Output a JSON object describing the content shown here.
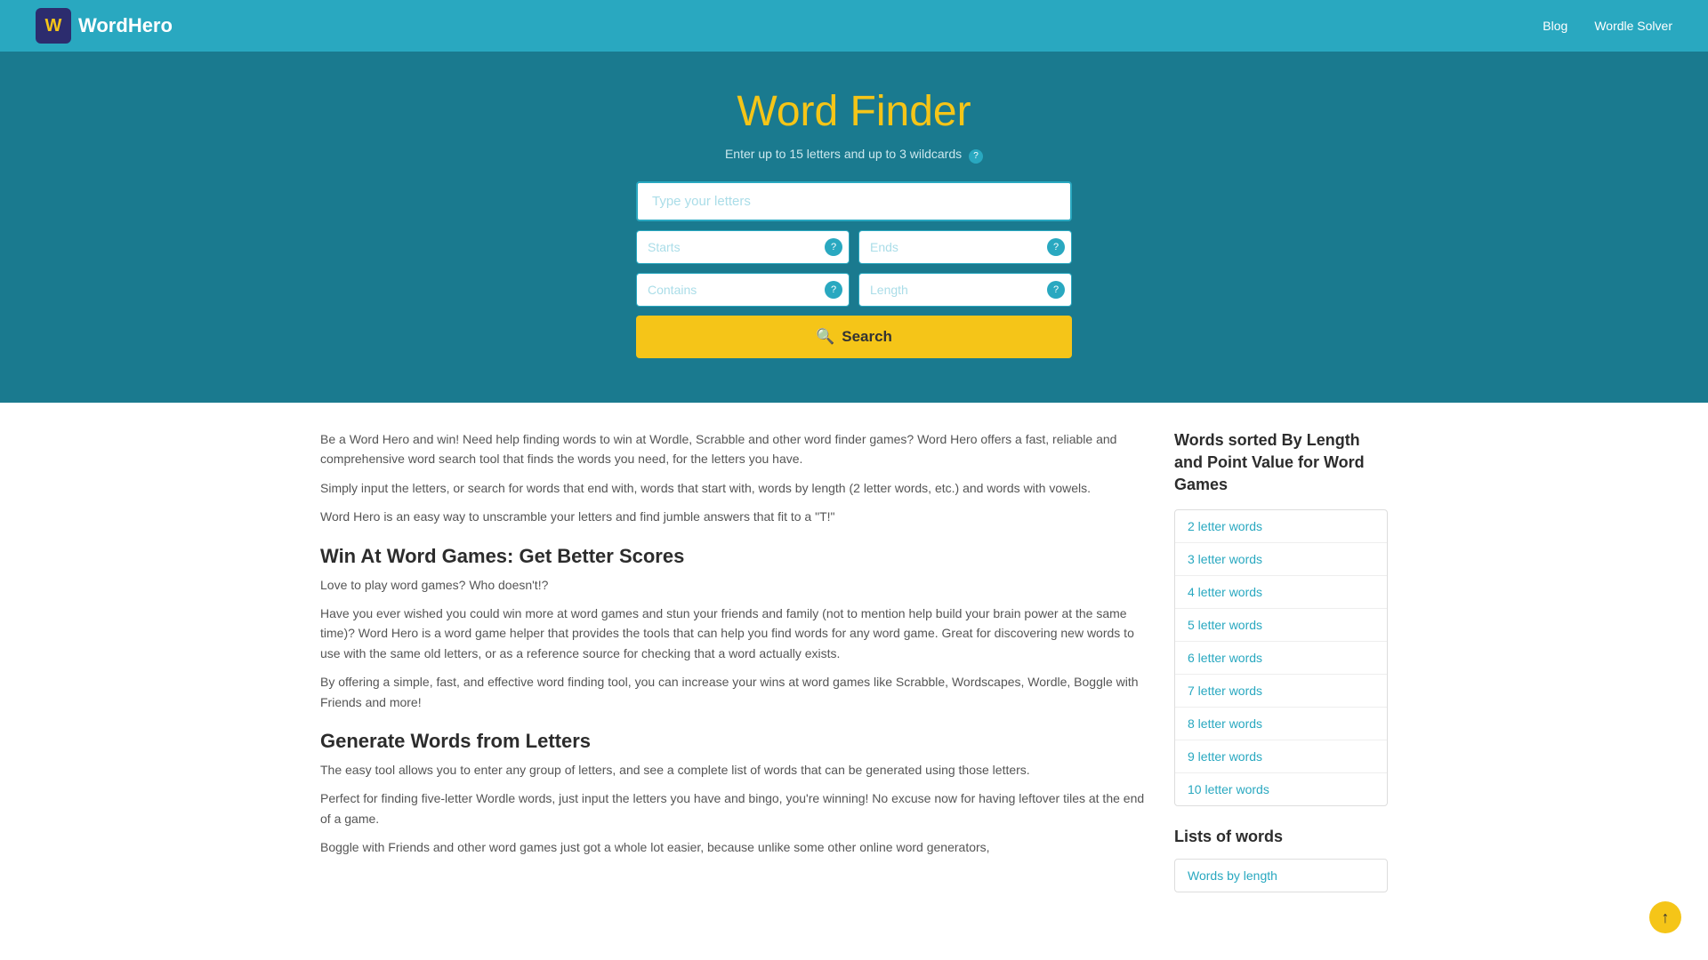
{
  "header": {
    "logo_text_part1": "Word",
    "logo_text_part2": "Hero",
    "logo_icon_letter": "W",
    "nav": {
      "blog_label": "Blog",
      "wordle_solver_label": "Wordle Solver"
    }
  },
  "hero": {
    "title_part1": "Word ",
    "title_part2": "Finder",
    "subtitle": "Enter up to 15 letters and up to 3 wildcards",
    "help_label": "?",
    "main_input_placeholder": "Type your letters",
    "starts_placeholder": "Starts",
    "ends_placeholder": "Ends",
    "contains_placeholder": "Contains",
    "length_placeholder": "Length",
    "search_button_label": "Search"
  },
  "content": {
    "intro1": "Be a Word Hero and win! Need help finding words to win at Wordle, Scrabble and other word finder games? Word Hero offers a fast, reliable and comprehensive word search tool that finds the words you need, for the letters you have.",
    "intro2": "Simply input the letters, or search for words that end with, words that start with, words by length (2 letter words, etc.) and words with vowels.",
    "intro3": "Word Hero is an easy way to unscramble your letters and find jumble answers that fit to a \"T!\"",
    "section1_heading": "Win At Word Games: Get Better Scores",
    "section1_para1": "Love to play word games? Who doesn't!?",
    "section1_para2": "Have you ever wished you could win more at word games and stun your friends and family (not to mention help build your brain power at the same time)? Word Hero is a word game helper that provides the tools that can help you find words for any word game. Great for discovering new words to use with the same old letters, or as a reference source for checking that a word actually exists.",
    "section1_para3": "By offering a simple, fast, and effective word finding tool, you can increase your wins at word games like Scrabble, Wordscapes, Wordle, Boggle with Friends and more!",
    "section2_heading": "Generate Words from Letters",
    "section2_para1": "The easy tool allows you to enter any group of letters, and see a complete list of words that can be generated using those letters.",
    "section2_para2": "Perfect for finding five-letter Wordle words, just input the letters you have and bingo, you're winning! No excuse now for having leftover tiles at the end of a game.",
    "section2_para3": "Boggle with Friends and other word games just got a whole lot easier, because unlike some other online word generators,"
  },
  "sidebar": {
    "words_by_length_heading": "Words sorted By Length and Point Value for Word Games",
    "word_length_links": [
      "2 letter words",
      "3 letter words",
      "4 letter words",
      "5 letter words",
      "6 letter words",
      "7 letter words",
      "8 letter words",
      "9 letter words",
      "10 letter words"
    ],
    "lists_heading": "Lists of words",
    "lists_links": [
      "Words by length"
    ]
  },
  "scroll_top": {
    "icon": "↑"
  }
}
